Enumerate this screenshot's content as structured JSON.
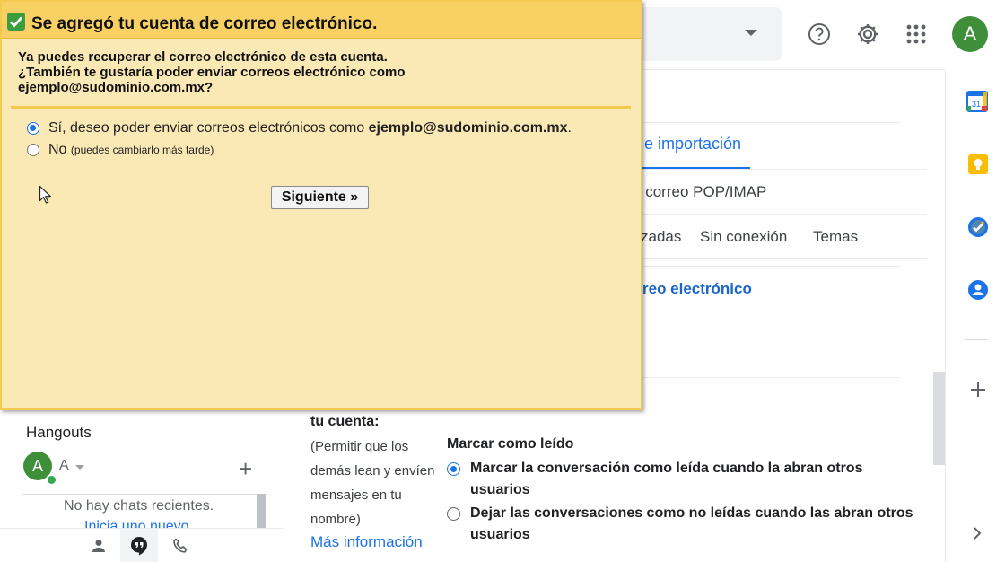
{
  "dialog": {
    "title": "Se agregó tu cuenta de correo electrónico.",
    "message_line1": "Ya puedes recuperar el correo electrónico de esta cuenta.",
    "message_line2": "¿También te gustaría poder enviar correos electrónico como",
    "message_line3": "ejemplo@sudominio.com.mx?",
    "option_yes_prefix": "Sí, deseo poder enviar correos electrónicos como ",
    "option_yes_email": "ejemplo@sudominio.com.mx",
    "option_yes_suffix": ".",
    "option_yes_selected": true,
    "option_no_label": "No",
    "option_no_note": "(puedes cambiarlo más tarde)",
    "next_button": "Siguiente »"
  },
  "header": {
    "avatar_letter": "A",
    "icons": [
      "help-icon",
      "settings-gear-icon",
      "apps-grid-icon"
    ]
  },
  "settings": {
    "tab_active": "e importación",
    "tab_pop": "y correo POP/IMAP",
    "tab_avanzadas": "zadas",
    "tab_offline": "Sin conexión",
    "tab_themes": "Temas",
    "account_link": "reo electrónico",
    "section_label": "tu cuenta:",
    "section_desc": "(Permitir que los demás lean y envíen mensajes en tu nombre)",
    "more_info": "Más información",
    "mark_read_title": "Marcar como leído",
    "mark_read_options": [
      {
        "label": "Marcar la conversación como leída cuando la abran otros usuarios",
        "selected": true
      },
      {
        "label": "Dejar las conversaciones como no leídas cuando las abran otros usuarios",
        "selected": false
      }
    ]
  },
  "hangouts": {
    "title": "Hangouts",
    "avatar_letter": "A",
    "user_name": "A",
    "empty_text": "No hay chats recientes.",
    "start_link": "Inicia uno nuevo"
  },
  "side_panel": {
    "apps": [
      "calendar-icon",
      "keep-icon",
      "tasks-icon",
      "contacts-icon"
    ],
    "calendar_day": "31"
  },
  "colors": {
    "dialog_bg": "#fbe9b5",
    "dialog_header": "#f9d063",
    "link_blue": "#1a73e8",
    "avatar_green": "#3f8f3a"
  }
}
